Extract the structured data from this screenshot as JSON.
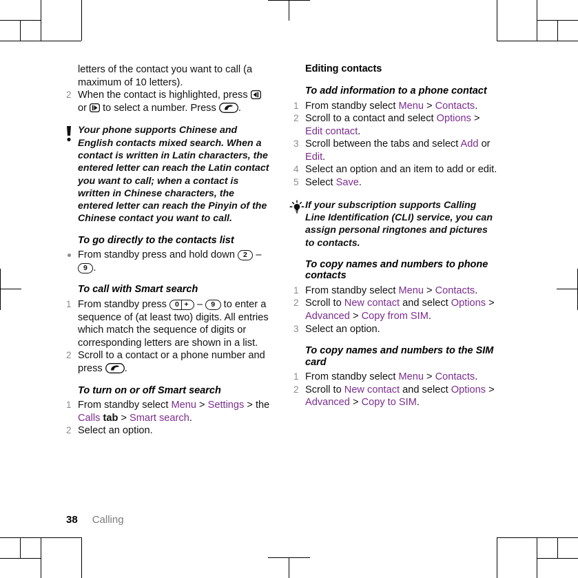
{
  "document": {
    "page_number": "38",
    "chapter": "Calling",
    "link_color": "#7b2d8e",
    "numeral_color": "#8c8c8c"
  },
  "left_column": {
    "continued_paragraph": {
      "prefix": "",
      "text": "letters of the contact you want to call (a maximum of 10 letters)."
    },
    "continued_step": {
      "number": "2",
      "part1": "When the contact is highlighted, press",
      "key_left": "nav-left-key",
      "conj": "or",
      "key_right": "nav-right-key",
      "part2": "to select a number. Press",
      "key_call": "call-key",
      "period": "."
    },
    "note": {
      "icon": "exclamation-note-icon",
      "text": "Your phone supports Chinese and English contacts mixed search. When a contact is written in Latin characters, the entered letter can reach the Latin contact you want to call; when a contact is written in Chinese characters, the entered letter can reach the Pinyin of the Chinese contact you want to call."
    },
    "section_contacts_list": {
      "heading": "To go directly to the contacts list",
      "bullet": {
        "part1": "From standby press and hold down",
        "key_from": "2",
        "dash": "–",
        "key_to": "9",
        "period": "."
      }
    },
    "section_smart_search": {
      "heading": "To call with Smart search",
      "steps": [
        {
          "number": "1",
          "part1": "From standby press",
          "key_from": "0",
          "key_from_extra": "+",
          "dash": "–",
          "key_to": "9",
          "part2": "to enter a sequence of (at least two) digits. All entries which match the sequence of digits or corresponding letters are shown in a list."
        },
        {
          "number": "2",
          "part1": "Scroll to a contact or a phone number and press",
          "key_call": "call-key",
          "period": "."
        }
      ]
    },
    "section_toggle_smart_search": {
      "heading": "To turn on or off Smart search",
      "steps": [
        {
          "number": "1",
          "fragments": [
            {
              "t": "From standby select ",
              "s": "plain"
            },
            {
              "t": "Menu",
              "s": "link"
            },
            {
              "t": " > ",
              "s": "plain"
            },
            {
              "t": "Settings",
              "s": "link"
            },
            {
              "t": " > the ",
              "s": "plain"
            },
            {
              "t": "Calls",
              "s": "link"
            },
            {
              "t": " tab",
              "s": "bold"
            },
            {
              "t": " > ",
              "s": "plain"
            },
            {
              "t": "Smart search",
              "s": "link"
            },
            {
              "t": ".",
              "s": "plain"
            }
          ]
        },
        {
          "number": "2",
          "fragments": [
            {
              "t": "Select an option.",
              "s": "plain"
            }
          ]
        }
      ]
    }
  },
  "right_column": {
    "section_title": "Editing contacts",
    "section_add_info": {
      "heading": "To add information to a phone contact",
      "steps": [
        {
          "number": "1",
          "fragments": [
            {
              "t": "From standby select ",
              "s": "plain"
            },
            {
              "t": "Menu",
              "s": "link"
            },
            {
              "t": " > ",
              "s": "plain"
            },
            {
              "t": "Contacts",
              "s": "link"
            },
            {
              "t": ".",
              "s": "plain"
            }
          ]
        },
        {
          "number": "2",
          "fragments": [
            {
              "t": "Scroll to a contact and select ",
              "s": "plain"
            },
            {
              "t": "Options",
              "s": "link"
            },
            {
              "t": " > ",
              "s": "plain"
            },
            {
              "t": "Edit contact",
              "s": "link"
            },
            {
              "t": ".",
              "s": "plain"
            }
          ]
        },
        {
          "number": "3",
          "fragments": [
            {
              "t": "Scroll between the tabs and select ",
              "s": "plain"
            },
            {
              "t": "Add",
              "s": "link"
            },
            {
              "t": " or ",
              "s": "plain"
            },
            {
              "t": "Edit",
              "s": "link"
            },
            {
              "t": ".",
              "s": "plain"
            }
          ]
        },
        {
          "number": "4",
          "fragments": [
            {
              "t": "Select an option and an item to add or edit.",
              "s": "plain"
            }
          ]
        },
        {
          "number": "5",
          "fragments": [
            {
              "t": "Select ",
              "s": "plain"
            },
            {
              "t": "Save",
              "s": "link"
            },
            {
              "t": ".",
              "s": "plain"
            }
          ]
        }
      ]
    },
    "tip": {
      "icon": "lightbulb-tip-icon",
      "text": "If your subscription supports Calling Line Identification (CLI) service, you can assign personal ringtones and pictures to contacts."
    },
    "section_copy_to_phone": {
      "heading": "To copy names and numbers to phone contacts",
      "steps": [
        {
          "number": "1",
          "fragments": [
            {
              "t": "From standby select ",
              "s": "plain"
            },
            {
              "t": "Menu",
              "s": "link"
            },
            {
              "t": " > ",
              "s": "plain"
            },
            {
              "t": "Contacts",
              "s": "link"
            },
            {
              "t": ".",
              "s": "plain"
            }
          ]
        },
        {
          "number": "2",
          "fragments": [
            {
              "t": "Scroll to ",
              "s": "plain"
            },
            {
              "t": "New contact",
              "s": "link"
            },
            {
              "t": " and select ",
              "s": "plain"
            },
            {
              "t": "Options",
              "s": "link"
            },
            {
              "t": " > ",
              "s": "plain"
            },
            {
              "t": "Advanced",
              "s": "link"
            },
            {
              "t": " > ",
              "s": "plain"
            },
            {
              "t": "Copy from SIM",
              "s": "link"
            },
            {
              "t": ".",
              "s": "plain"
            }
          ]
        },
        {
          "number": "3",
          "fragments": [
            {
              "t": "Select an option.",
              "s": "plain"
            }
          ]
        }
      ]
    },
    "section_copy_to_sim": {
      "heading": "To copy names and numbers to the SIM card",
      "steps": [
        {
          "number": "1",
          "fragments": [
            {
              "t": "From standby select ",
              "s": "plain"
            },
            {
              "t": "Menu",
              "s": "link"
            },
            {
              "t": " > ",
              "s": "plain"
            },
            {
              "t": "Contacts",
              "s": "link"
            },
            {
              "t": ".",
              "s": "plain"
            }
          ]
        },
        {
          "number": "2",
          "fragments": [
            {
              "t": "Scroll to ",
              "s": "plain"
            },
            {
              "t": "New contact",
              "s": "link"
            },
            {
              "t": " and select ",
              "s": "plain"
            },
            {
              "t": "Options",
              "s": "link"
            },
            {
              "t": " > ",
              "s": "plain"
            },
            {
              "t": "Advanced",
              "s": "link"
            },
            {
              "t": " > ",
              "s": "plain"
            },
            {
              "t": "Copy to SIM",
              "s": "link"
            },
            {
              "t": ".",
              "s": "plain"
            }
          ]
        }
      ]
    }
  }
}
